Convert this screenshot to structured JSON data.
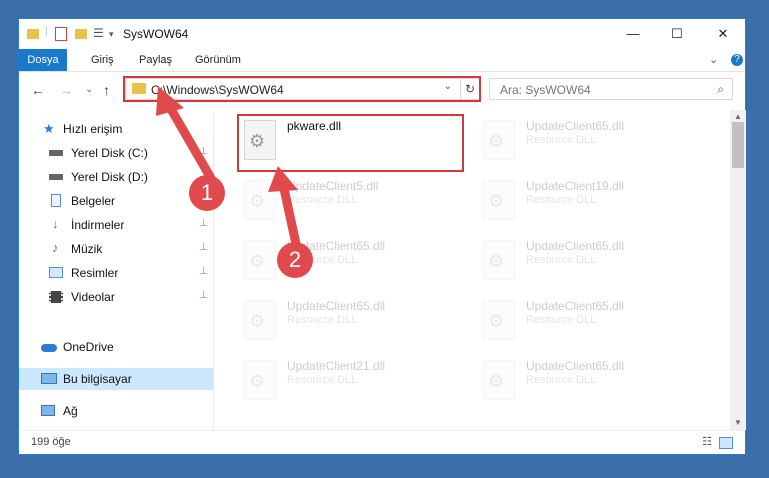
{
  "window": {
    "title": "SysWOW64",
    "controls": {
      "minimize": "—",
      "maximize": "☐",
      "close": "✕"
    }
  },
  "ribbon": {
    "tabs": [
      {
        "label": "Dosya"
      },
      {
        "label": "Giriş"
      },
      {
        "label": "Paylaş"
      },
      {
        "label": "Görünüm"
      }
    ],
    "expand": "⌄",
    "help": "?"
  },
  "nav": {
    "back": "←",
    "forward": "→",
    "recent": "⌄",
    "up": "↑",
    "address_path": "C:\\Windows\\SysWOW64",
    "address_dropdown": "⌄",
    "refresh": "↻",
    "search_placeholder": "Ara: SysWOW64"
  },
  "sidebar": {
    "items": [
      {
        "label": "Hızlı erişim",
        "icon": "star-icon",
        "pinned": false
      },
      {
        "label": "Yerel Disk (C:)",
        "icon": "drive-icon",
        "pinned": true
      },
      {
        "label": "Yerel Disk (D:)",
        "icon": "drive-icon",
        "pinned": true
      },
      {
        "label": "Belgeler",
        "icon": "documents-icon",
        "pinned": true
      },
      {
        "label": "İndirmeler",
        "icon": "downloads-icon",
        "pinned": true
      },
      {
        "label": "Müzik",
        "icon": "music-icon",
        "pinned": true
      },
      {
        "label": "Resimler",
        "icon": "pictures-icon",
        "pinned": true
      },
      {
        "label": "Videolar",
        "icon": "videos-icon",
        "pinned": true
      },
      {
        "label": "OneDrive",
        "icon": "cloud-icon",
        "pinned": false
      },
      {
        "label": "Bu bilgisayar",
        "icon": "computer-icon",
        "pinned": false,
        "selected": true
      },
      {
        "label": "Ağ",
        "icon": "network-icon",
        "pinned": false
      }
    ],
    "pin_glyph": "📌"
  },
  "files": [
    {
      "name": "pkware.dll",
      "type": "",
      "highlighted": true
    },
    {
      "name": "UpdateClient65.dll",
      "type": "Resource DLL"
    },
    {
      "name": "UpdateClient5.dll",
      "type": "Resource DLL"
    },
    {
      "name": "UpdateClient19.dll",
      "type": "Resource DLL"
    },
    {
      "name": "UpdateClient65.dll",
      "type": "Resource DLL"
    },
    {
      "name": "UpdateClient65.dll",
      "type": "Resource DLL"
    },
    {
      "name": "UpdateClient65.dll",
      "type": "Resource DLL"
    },
    {
      "name": "UpdateClient65.dll",
      "type": "Resource DLL"
    },
    {
      "name": "UpdateClient21.dll",
      "type": "Resource DLL"
    },
    {
      "name": "UpdateClient65.dll",
      "type": "Resource DLL"
    }
  ],
  "status": {
    "item_count": "199 öğe"
  },
  "annotations": [
    {
      "label": "1"
    },
    {
      "label": "2"
    }
  ],
  "colors": {
    "accent": "#1979ca",
    "highlight": "#d2393a",
    "selection": "#cce8ff"
  }
}
